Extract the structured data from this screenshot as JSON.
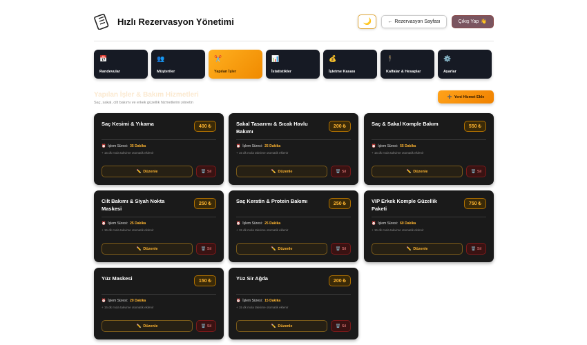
{
  "header": {
    "title": "Hızlı Rezervasyon Yönetimi",
    "logo_icon": "notebook-icon",
    "theme_icon": "🌙",
    "reservation_page_label": "Rezervasyon Sayfası",
    "reservation_page_arrow": "←",
    "logout_label": "Çıkış Yap",
    "logout_icon": "👋"
  },
  "tabs": [
    {
      "label": "Randevular",
      "icon": "📅"
    },
    {
      "label": "Müşteriler",
      "icon": "👥"
    },
    {
      "label": "Yapılan İşler",
      "icon": "✂️"
    },
    {
      "label": "İstatistikler",
      "icon": "📊"
    },
    {
      "label": "İşletme Kasası",
      "icon": "💰"
    },
    {
      "label": "Kalfalar & Hesaplar",
      "icon": "🕴"
    },
    {
      "label": "Ayarlar",
      "icon": "⚙️"
    }
  ],
  "active_tab": "Yapılan İşler",
  "section": {
    "title": "Yapılan İşler & Bakım Hizmetleri",
    "subtitle": "Saç, sakal, cilt bakımı ve erkek güzellik hizmetlerini yönetin",
    "add_button_label": "Yeni Hizmet Ekle",
    "add_button_icon": "➕"
  },
  "common": {
    "duration_label": "İşlem Süresi:",
    "duration_icon": "⏰",
    "break_note": "+ 15 dk mola takvime otomatik eklenir",
    "edit_label": "Düzenle",
    "edit_icon": "✏️",
    "delete_label": "Sil",
    "delete_icon": "🗑️"
  },
  "services": [
    {
      "name": "Saç Kesimi & Yıkama",
      "price": "400 ₺",
      "duration": "35 Dakika",
      "edit_label": "Düzenle",
      "delete_label": "Sil"
    },
    {
      "name": "Sakal Tasarımı & Sıcak Havlu Bakımı",
      "price": "200 ₺",
      "duration": "25 Dakika",
      "edit_label": "Düzenle",
      "delete_label": "Sil"
    },
    {
      "name": "Saç & Sakal Komple Bakım",
      "price": "550 ₺",
      "duration": "55 Dakika",
      "edit_label": "Düzenle",
      "delete_label": "Sil"
    },
    {
      "name": "Cilt Bakımı & Siyah Nokta Maskesi",
      "price": "250 ₺",
      "duration": "25 Dakika",
      "edit_label": "Düzenle",
      "delete_label": "Sil"
    },
    {
      "name": "Saç Keratin & Protein Bakımı",
      "price": "250 ₺",
      "duration": "25 Dakika",
      "edit_label": "Düzenle",
      "delete_label": "Sil"
    },
    {
      "name": "VIP Erkek Komple Güzellik Paketi",
      "price": "750 ₺",
      "duration": "60 Dakika",
      "edit_label": "Düzenle",
      "delete_label": "Sil"
    },
    {
      "name": "Yüz Maskesi",
      "price": "150 ₺",
      "duration": "20 Dakika",
      "edit_label": "Düzenle",
      "delete_label": "Sil"
    },
    {
      "name": "Yüz Sir Ağda",
      "price": "200 ₺",
      "duration": "15 Dakika",
      "edit_label": "Düzenle",
      "delete_label": "Sil"
    }
  ]
}
